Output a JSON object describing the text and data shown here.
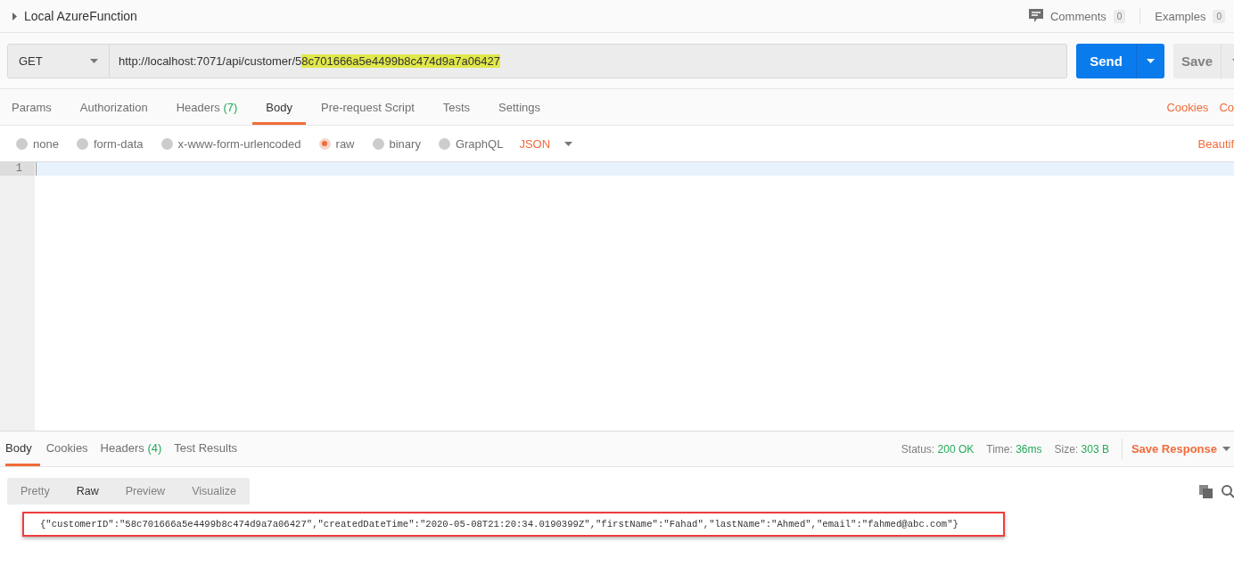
{
  "request": {
    "title": "Local AzureFunction",
    "comments": {
      "label": "Comments",
      "count": "0"
    },
    "examples": {
      "label": "Examples",
      "count": "0"
    }
  },
  "url_bar": {
    "method": "GET",
    "url": "http://localhost:7071/api/customer/5",
    "url_highlight": "8c701666a5e4499b8c474d9a7a06427",
    "send": "Send",
    "save": "Save"
  },
  "request_tabs": [
    {
      "label": "Params",
      "selected": false
    },
    {
      "label": "Authorization",
      "selected": false
    },
    {
      "label": "Headers",
      "count": "(7)",
      "selected": false
    },
    {
      "label": "Body",
      "selected": true
    },
    {
      "label": "Pre-request Script",
      "selected": false
    },
    {
      "label": "Tests",
      "selected": false
    },
    {
      "label": "Settings",
      "selected": false
    }
  ],
  "request_links": [
    "Cookies",
    "Co"
  ],
  "body_types": [
    {
      "label": "none",
      "selected": false
    },
    {
      "label": "form-data",
      "selected": false
    },
    {
      "label": "x-www-form-urlencoded",
      "selected": false
    },
    {
      "label": "raw",
      "selected": true
    },
    {
      "label": "binary",
      "selected": false
    },
    {
      "label": "GraphQL",
      "selected": false
    }
  ],
  "raw_format": "JSON",
  "beautify": "Beautif",
  "editor": {
    "line_numbers": [
      "1"
    ]
  },
  "response_tabs": [
    {
      "label": "Body",
      "selected": true
    },
    {
      "label": "Cookies",
      "selected": false
    },
    {
      "label": "Headers",
      "count": "(4)",
      "selected": false
    },
    {
      "label": "Test Results",
      "selected": false
    }
  ],
  "response_meta": [
    {
      "label": "Status:",
      "value": "200 OK"
    },
    {
      "label": "Time:",
      "value": "36ms"
    },
    {
      "label": "Size:",
      "value": "303 B"
    }
  ],
  "save_response": "Save Response",
  "view_modes": [
    {
      "label": "Pretty",
      "selected": false
    },
    {
      "label": "Raw",
      "selected": true
    },
    {
      "label": "Preview",
      "selected": false
    },
    {
      "label": "Visualize",
      "selected": false
    }
  ],
  "response_body": "{\"customerID\":\"58c701666a5e4499b8c474d9a7a06427\",\"createdDateTime\":\"2020-05-08T21:20:34.0190399Z\",\"firstName\":\"Fahad\",\"lastName\":\"Ahmed\",\"email\":\"fahmed@abc.com\"}"
}
